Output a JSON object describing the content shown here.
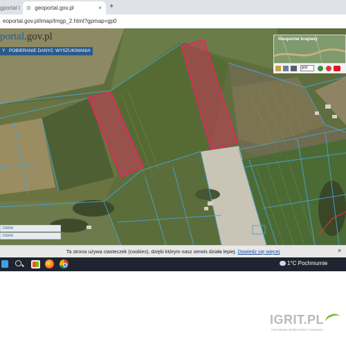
{
  "browser": {
    "tabs": [
      {
        "title": "gportal l"
      },
      {
        "title": "geoportal.gov.pl",
        "active": true
      }
    ],
    "new_tab": "+",
    "close_glyph": "×",
    "url": "eoportal.gov.pl/imap/Imgp_2.html?gpmap=gp0"
  },
  "app": {
    "brand_name": "portal",
    "brand_domain": ".gov.pl",
    "menu": [
      "Y",
      "POBIERANIE DANYCH",
      "WYSZUKIWANIA"
    ],
    "overview_title": "Geoportal krajowy",
    "zoom_value": "pol",
    "left_panel": [
      "rzono",
      "rzono"
    ],
    "colors": {
      "parcel_outline": "#e8245a",
      "parcel_fill": "#c83a5a",
      "boundaries": "#4aa6d8",
      "brand": "#1d5a9f"
    }
  },
  "cookie": {
    "text": "Ta strona używa ciasteczek (cookies), dzięki którym nasz serwis działa lepiej.",
    "link": "Dowiedz się więcej",
    "close": "×"
  },
  "taskbar": {
    "icons": [
      "windows-icon",
      "search-icon",
      "store-icon",
      "firefox-icon",
      "chrome-icon"
    ],
    "weather": "1°C  Pochmurnie"
  },
  "watermark": {
    "logo": "IGRIT.PL",
    "sub": "Internetowa Giełda Rolna i Towarowa"
  }
}
